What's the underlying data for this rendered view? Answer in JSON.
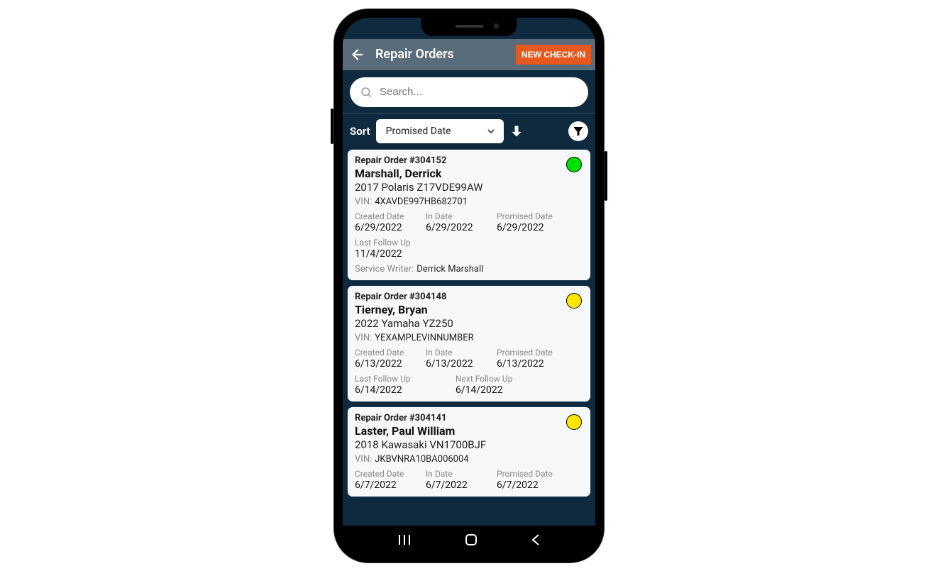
{
  "header": {
    "title": "Repair Orders",
    "new_checkin": "NEW CHECK-IN"
  },
  "search": {
    "placeholder": "Search..."
  },
  "sort": {
    "label": "Sort",
    "selected": "Promised Date"
  },
  "orders": [
    {
      "ro": "Repair Order #304152",
      "customer": "Marshall, Derrick",
      "vehicle": "2017 Polaris Z17VDE99AW",
      "vin": "4XAVDE997HB682701",
      "created_label": "Created Date",
      "created": "6/29/2022",
      "indate_label": "In Date",
      "indate": "6/29/2022",
      "promised_label": "Promised Date",
      "promised": "6/29/2022",
      "last_fu_label": "Last Follow Up",
      "last_fu": "11/4/2022",
      "next_fu_label": "",
      "next_fu": "",
      "sw_label": "Service Writer:",
      "sw": "Derrick Marshall",
      "status": "green"
    },
    {
      "ro": "Repair Order #304148",
      "customer": "Tierney, Bryan",
      "vehicle": "2022 Yamaha YZ250",
      "vin": "YEXAMPLEVINNUMBER",
      "created_label": "Created Date",
      "created": "6/13/2022",
      "indate_label": "In Date",
      "indate": "6/13/2022",
      "promised_label": "Promised Date",
      "promised": "6/13/2022",
      "last_fu_label": "Last Follow Up",
      "last_fu": "6/14/2022",
      "next_fu_label": "Next Follow Up",
      "next_fu": "6/14/2022",
      "sw_label": "",
      "sw": "",
      "status": "yellow"
    },
    {
      "ro": "Repair Order #304141",
      "customer": "Laster, Paul William",
      "vehicle": "2018 Kawasaki VN1700BJF",
      "vin": "JKBVNRA10BA006004",
      "created_label": "Created Date",
      "created": "6/7/2022",
      "indate_label": "In Date",
      "indate": "6/7/2022",
      "promised_label": "Promised Date",
      "promised": "6/7/2022",
      "last_fu_label": "",
      "last_fu": "",
      "next_fu_label": "",
      "next_fu": "",
      "sw_label": "",
      "sw": "",
      "status": "yellow"
    }
  ],
  "labels": {
    "vin": "VIN:"
  }
}
